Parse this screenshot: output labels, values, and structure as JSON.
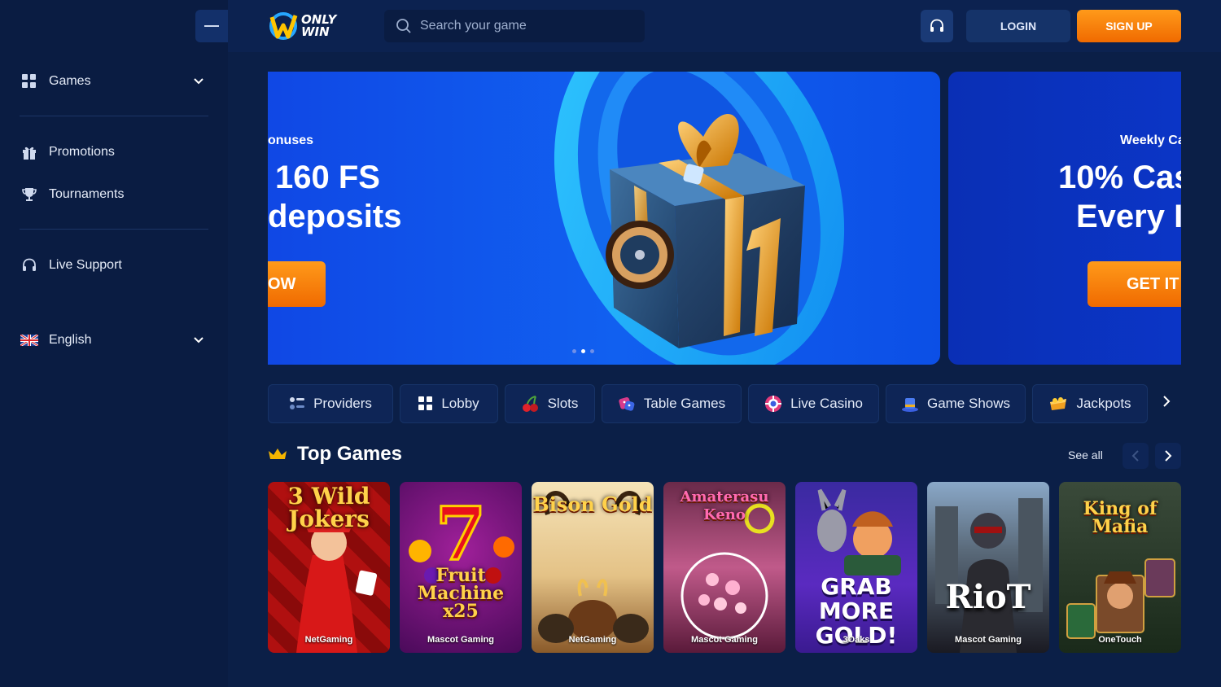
{
  "sidebar": {
    "items": [
      {
        "label": "Games",
        "icon": "grid-icon"
      },
      {
        "label": "Promotions",
        "icon": "gift-icon"
      },
      {
        "label": "Tournaments",
        "icon": "trophy-icon"
      },
      {
        "label": "Live Support",
        "icon": "headset-icon"
      },
      {
        "label": "English",
        "icon": "uk-flag-icon"
      }
    ]
  },
  "header": {
    "logo_line1": "ONLY",
    "logo_line2": "WIN",
    "search_placeholder": "Search your game",
    "login_label": "LOGIN",
    "signup_label": "SIGN UP"
  },
  "banner": {
    "main": {
      "tag": "onuses",
      "line1": "160 FS",
      "line2": "deposits",
      "cta": "OW"
    },
    "next": {
      "tag": "Weekly Ca",
      "line1": "10% Cas",
      "line2": "Every I",
      "cta": "GET IT"
    }
  },
  "categories": [
    {
      "label": "Providers",
      "icon": "providers-icon"
    },
    {
      "label": "Lobby",
      "icon": "grid-icon"
    },
    {
      "label": "Slots",
      "icon": "cherry-icon"
    },
    {
      "label": "Table Games",
      "icon": "dice-icon"
    },
    {
      "label": "Live Casino",
      "icon": "chip-icon"
    },
    {
      "label": "Game Shows",
      "icon": "top-hat-icon"
    },
    {
      "label": "Jackpots",
      "icon": "jackpot-icon"
    }
  ],
  "top_games": {
    "title": "Top Games",
    "see_all": "See all",
    "games": [
      {
        "title": "3 Wild Jokers",
        "provider": "NetGaming"
      },
      {
        "title": "Fruit Machine x25",
        "provider": "Mascot Gaming"
      },
      {
        "title": "Bison Gold",
        "provider": "NetGaming"
      },
      {
        "title": "Amaterasu Keno",
        "provider": "Mascot Gaming"
      },
      {
        "title": "GRAB MORE GOLD!",
        "provider": "3Oaks"
      },
      {
        "title": "RioT",
        "provider": "Mascot Gaming"
      },
      {
        "title": "King of Mafia",
        "provider": "OneTouch"
      }
    ]
  },
  "colors": {
    "background": "#0b1f47",
    "accent_orange": "#f47a00",
    "banner_blue": "#1160f0"
  }
}
